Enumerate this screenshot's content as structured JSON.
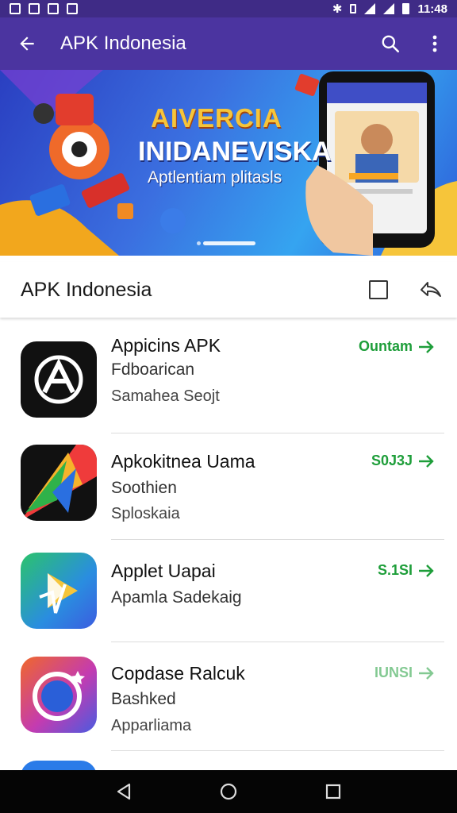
{
  "status_bar": {
    "time": "11:48"
  },
  "app_bar": {
    "title": "APK Indonesia"
  },
  "banner": {
    "title": "AIVERCIA",
    "subtitle": "INIDANEVISKA",
    "tagline": "Aptlentiam plitasls"
  },
  "sub_header": {
    "title": "APK Indonesia"
  },
  "apps": [
    {
      "name": "Appicins APK",
      "line2": "Fdboarican",
      "line3": "Samahea Seojt",
      "action": "Ountam"
    },
    {
      "name": "Apkokitnea Uama",
      "line2": "Soothien",
      "line3": "Sploskaia",
      "action": "S0J3J"
    },
    {
      "name": "Applet Uapai",
      "line2": "Apamla Sadekaig",
      "line3": "",
      "action": "S.1SI"
    },
    {
      "name": "Copdase Ralcuk",
      "line2": "Bashked",
      "line3": "Apparliama",
      "action": "IUNSI"
    }
  ],
  "colors": {
    "status_bar": "#3f2b86",
    "app_bar": "#4b34a0",
    "accent_green": "#1e9e3a",
    "nav_bar": "#050505"
  }
}
